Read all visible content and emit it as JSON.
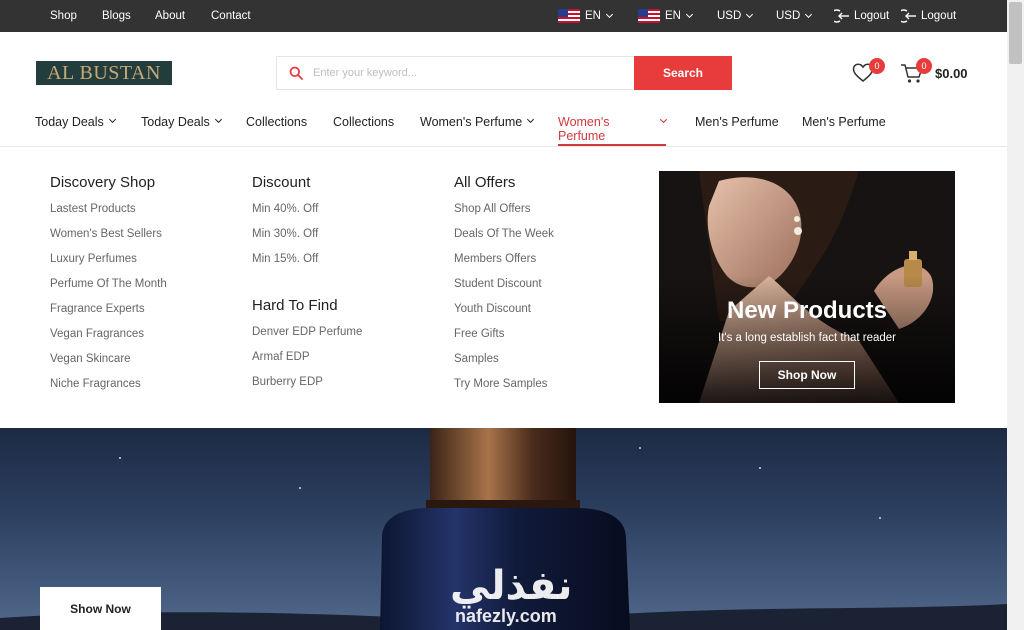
{
  "topbar": {
    "links": [
      "Shop",
      "Blogs",
      "About",
      "Contact"
    ],
    "language_1": "EN",
    "language_2": "EN",
    "currency_1": "USD",
    "currency_2": "USD",
    "logout_1": "Logout",
    "logout_2": "Logout"
  },
  "header": {
    "logo_text": "AL BUSTAN",
    "search_placeholder": "Enter your keyword...",
    "search_button": "Search",
    "wishlist_count": "0",
    "cart_count": "0",
    "cart_total": "$0.00"
  },
  "nav": {
    "items": [
      "Today Deals",
      "Today Deals",
      "Collections",
      "Collections",
      "Women's Perfume",
      "Women's Perfume",
      "Men's Perfume",
      "Men's Perfume"
    ]
  },
  "mega_menu": {
    "discovery": {
      "title": "Discovery Shop",
      "links": [
        "Lastest Products",
        "Women's Best Sellers",
        "Luxury Perfumes",
        "Perfume Of The Month",
        "Fragrance Experts",
        "Vegan Fragrances",
        "Vegan Skincare",
        "Niche Fragrances"
      ]
    },
    "discount": {
      "title": "Discount",
      "links": [
        "Min 40%. Off",
        "Min 30%. Off",
        "Min 15%. Off"
      ]
    },
    "hard_to_find": {
      "title": "Hard To Find",
      "links": [
        "Denver EDP Perfume",
        "Armaf EDP",
        "Burberry EDP"
      ]
    },
    "offers": {
      "title": "All Offers",
      "links": [
        "Shop All Offers",
        "Deals Of The Week",
        "Members Offers",
        "Student Discount",
        "Youth Discount",
        "Free Gifts",
        "Samples",
        "Try More Samples"
      ]
    },
    "promo": {
      "title": "New Products",
      "subtitle": "It's a long establish fact that reader",
      "button": "Shop Now"
    }
  },
  "hero": {
    "button": "Show Now",
    "watermark": "نفذلي",
    "watermark_sub": "nafezly.com"
  },
  "colors": {
    "accent": "#e83c3c",
    "topbar": "#333333",
    "nav_active": "#d1393c",
    "logo_bg": "#233d3c",
    "logo_text": "#c7a877"
  }
}
